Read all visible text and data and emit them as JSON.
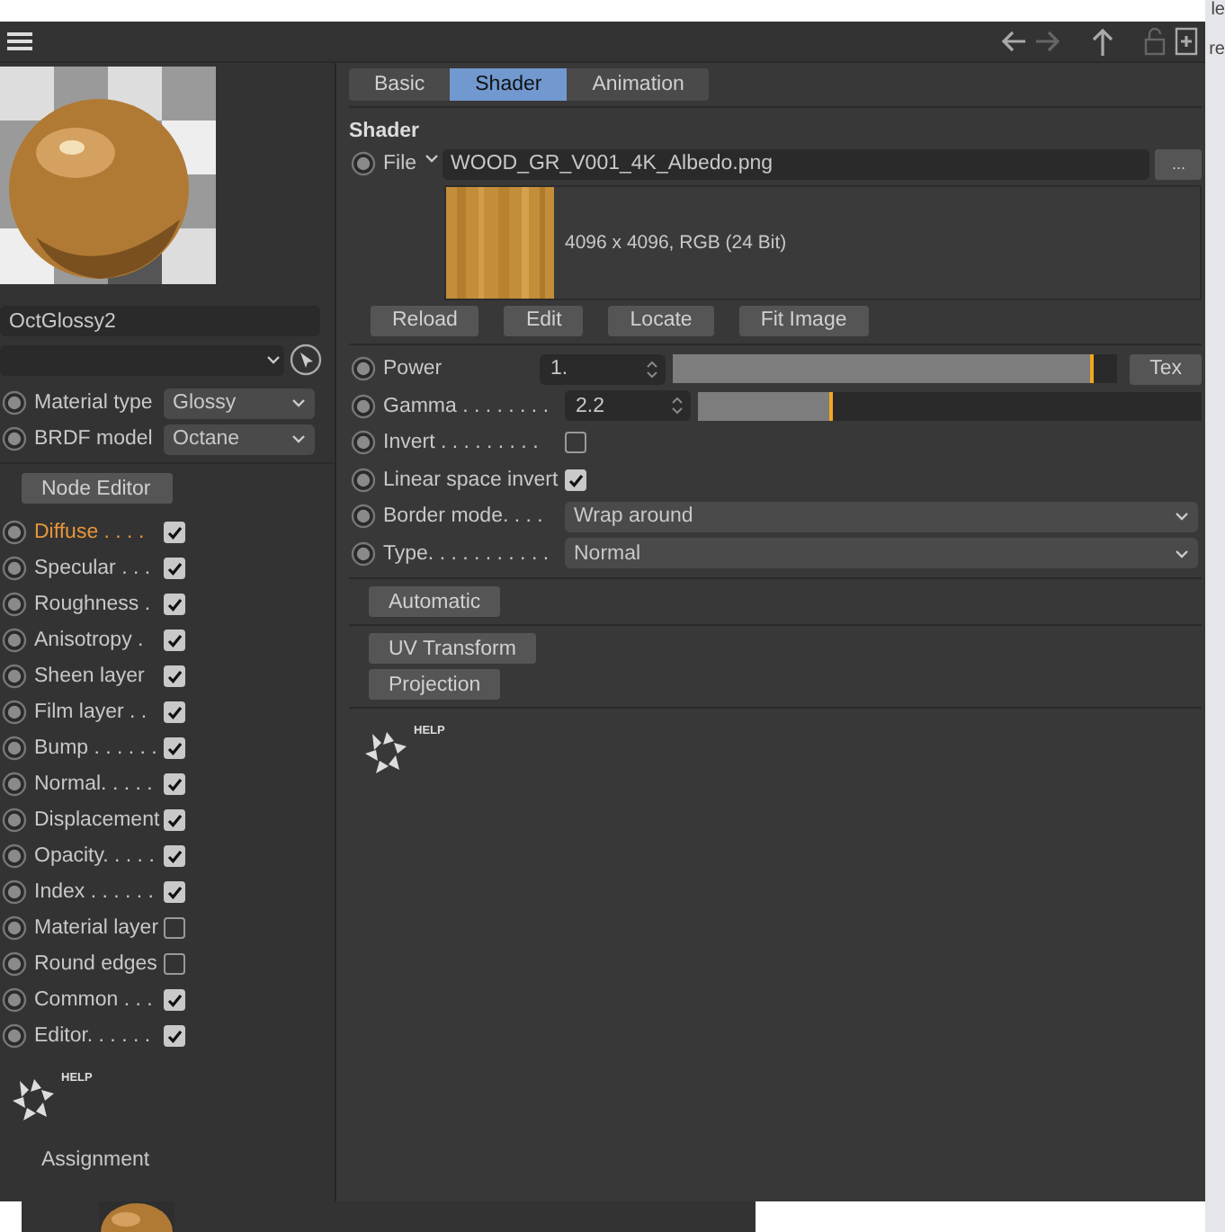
{
  "background_texts": [
    "le",
    "re"
  ],
  "toolbar": {
    "icons": [
      {
        "kind": "back",
        "disabled": false
      },
      {
        "kind": "forward",
        "disabled": true
      },
      {
        "kind": "up",
        "disabled": false
      },
      {
        "kind": "lock",
        "disabled": true
      },
      {
        "kind": "new",
        "disabled": false
      }
    ]
  },
  "material": {
    "name": "OctGlossy2"
  },
  "params": [
    {
      "label": "Material type",
      "value": "Glossy"
    },
    {
      "label": "BRDF model",
      "value": "Octane"
    }
  ],
  "node_editor": "Node Editor",
  "channels": [
    {
      "label": "Diffuse . . . .",
      "checked": true,
      "selected": true
    },
    {
      "label": "Specular . . .",
      "checked": true,
      "selected": false
    },
    {
      "label": "Roughness .",
      "checked": true,
      "selected": false
    },
    {
      "label": "Anisotropy .",
      "checked": true,
      "selected": false
    },
    {
      "label": "Sheen layer",
      "checked": true,
      "selected": false
    },
    {
      "label": "Film layer . .",
      "checked": true,
      "selected": false
    },
    {
      "label": "Bump . . . . . .",
      "checked": true,
      "selected": false
    },
    {
      "label": "Normal. . . . .",
      "checked": true,
      "selected": false
    },
    {
      "label": "Displacement",
      "checked": true,
      "selected": false
    },
    {
      "label": "Opacity. . . . .",
      "checked": true,
      "selected": false
    },
    {
      "label": "Index . . . . . .",
      "checked": true,
      "selected": false
    },
    {
      "label": "Material layer",
      "checked": false,
      "selected": false
    },
    {
      "label": "Round edges",
      "checked": false,
      "selected": false
    },
    {
      "label": "Common . . .",
      "checked": true,
      "selected": false
    },
    {
      "label": "Editor. . . . . .",
      "checked": true,
      "selected": false
    }
  ],
  "left_help": "HELP",
  "assignment": "Assignment",
  "tabs": [
    {
      "label": "Basic",
      "selected": false
    },
    {
      "label": "Shader",
      "selected": true
    },
    {
      "label": "Animation",
      "selected": false
    }
  ],
  "shader": {
    "title": "Shader",
    "file_label": "File",
    "file": "WOOD_GR_V001_4K_Albedo.png",
    "browse": "...",
    "image_info": "4096 x 4096, RGB (24 Bit)",
    "buttons": [
      "Reload",
      "Edit",
      "Locate",
      "Fit Image"
    ]
  },
  "properties": [
    {
      "kind": "slider",
      "label": "Power",
      "value": "1.",
      "level": 0.94,
      "button": "Tex"
    },
    {
      "kind": "slider",
      "label": "Gamma . . . . . . . .",
      "value": "2.2",
      "level": 0.26
    },
    {
      "kind": "checkbox",
      "label": "Invert . . . . . . . . .",
      "checked": false
    },
    {
      "kind": "checkbox",
      "label": "Linear space invert",
      "checked": true
    },
    {
      "kind": "dropdown",
      "label": "Border mode. . . .",
      "value": "Wrap around"
    },
    {
      "kind": "dropdown",
      "label": "Type. . . . . . . . . . .",
      "value": "Normal"
    }
  ],
  "button_groups": [
    [
      "Automatic"
    ],
    [
      "UV Transform",
      "Projection"
    ]
  ],
  "right_help": "HELP"
}
